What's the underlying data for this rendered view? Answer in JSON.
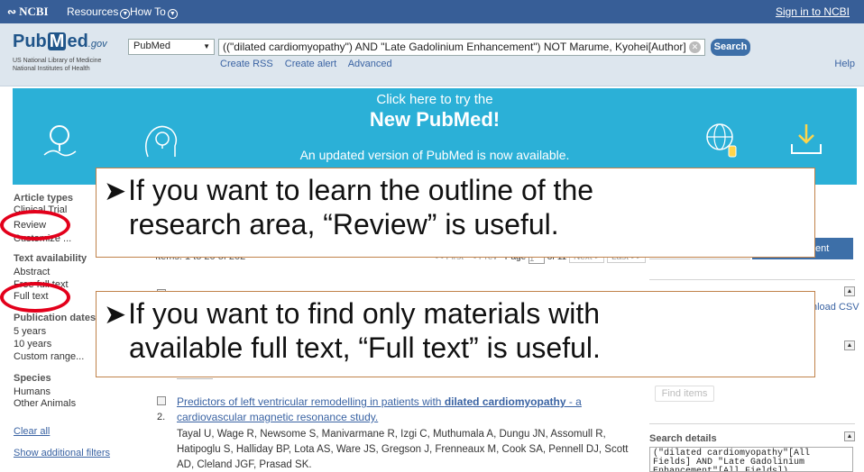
{
  "topbar": {
    "ncbi_label": "NCBI",
    "resources_label": "Resources",
    "howto_label": "How To",
    "signin_label": "Sign in to NCBI"
  },
  "header": {
    "logo_pub": "Pub",
    "logo_m": "M",
    "logo_ed": "ed",
    "logo_gov": ".gov",
    "logo_sub1": "US National Library of Medicine",
    "logo_sub2": "National Institutes of Health",
    "db_selected": "PubMed",
    "search_query": "((\"dilated cardiomyopathy\") AND \"Late Gadolinium Enhancement\") NOT Marume, Kyohei[Author]",
    "search_button": "Search",
    "links": [
      "Create RSS",
      "Create alert",
      "Advanced"
    ],
    "help_label": "Help"
  },
  "banner": {
    "line1": "Click here to try the",
    "line2": "New PubMed!",
    "line3": "An updated version of PubMed is now available.",
    "colors": {
      "background": "#2bb0d7"
    }
  },
  "sidebar": {
    "article_types_head": "Article types",
    "clinical_trial": "Clinical Trial",
    "review": "Review",
    "customize": "Customize ...",
    "text_availability_head": "Text availability",
    "abstract": "Abstract",
    "free_full_text": "Free full text",
    "full_text": "Full text",
    "publication_dates_head": "Publication dates",
    "years5": "5 years",
    "years10": "10 years",
    "custom_range": "Custom range...",
    "species_head": "Species",
    "humans": "Humans",
    "other_animals": "Other Animals",
    "clear_all": "Clear all",
    "show_filters": "Show additional filters"
  },
  "results": {
    "items_line": "Items: 1 to 20 of 202",
    "pager_first": "<< First",
    "pager_prev": "< Prev",
    "pager_page": "Page",
    "pager_page_value": "1",
    "pager_of": "of 11",
    "pager_next": "Next >",
    "pager_last": "Last >>",
    "item2": {
      "number": "2.",
      "title_pre": "Predictors of left ventricular remodelling in patients with ",
      "title_bold": "dilated cardiomyopathy",
      "title_post": " - a cardiovascular magnetic resonance study.",
      "authors": "Tayal U, Wage R, Newsome S, Manivarmane R, Izgi C, Muthumala A, Dungu JN, Assomull R, Hatipoglu S, Halliday BP, Lota AS, Ware JS, Gregson J, Frenneaux M, Cook SA, Pennell DJ, Scott AD, Cleland JGF, Prasad SK."
    }
  },
  "right": {
    "send_to_button": "ent",
    "download_csv": "nload CSV",
    "find_items": "Find items",
    "search_details_head": "Search details",
    "search_details_text": "(\"dilated cardiomyopathy\"[All Fields] AND \"Late Gadolinium Enhancement\"[All Fields])"
  },
  "callouts": {
    "top_line1": "If you want to learn the outline of the",
    "top_line2": "research area, “Review” is useful.",
    "bottom_line1": "If you want to find only materials with",
    "bottom_line2": "available full text, “Full text” is useful.",
    "highlight_color": "#e3001b"
  }
}
